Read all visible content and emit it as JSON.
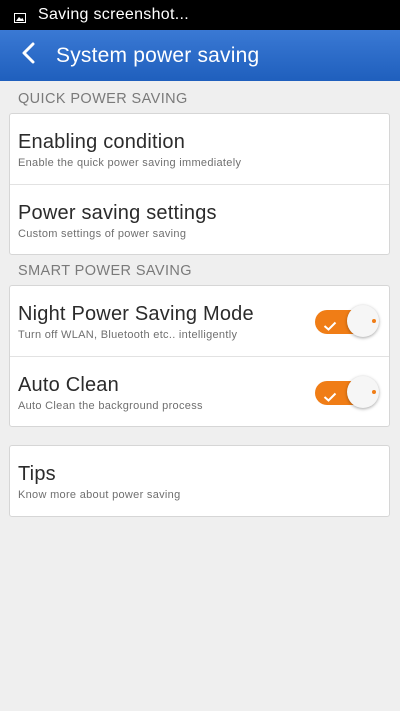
{
  "status_bar": {
    "text": "Saving screenshot...",
    "icon": "image-icon"
  },
  "app_bar": {
    "back_icon": "chevron-left-icon",
    "title": "System power saving",
    "color": "#2a6bcb"
  },
  "sections": {
    "quick": {
      "header": "QUICK POWER SAVING",
      "items": [
        {
          "title": "Enabling condition",
          "subtitle": "Enable the quick power saving immediately"
        },
        {
          "title": "Power saving settings",
          "subtitle": "Custom settings of power saving"
        }
      ]
    },
    "smart": {
      "header": "SMART POWER SAVING",
      "items": [
        {
          "title": "Night Power Saving Mode",
          "subtitle": "Turn off WLAN, Bluetooth etc.. intelligently",
          "enabled": true
        },
        {
          "title": "Auto Clean",
          "subtitle": "Auto Clean the background process",
          "enabled": true
        }
      ]
    },
    "tips": {
      "items": [
        {
          "title": "Tips",
          "subtitle": "Know more about power saving"
        }
      ]
    }
  },
  "colors": {
    "accent": "#f07d16",
    "background": "#efefef"
  }
}
